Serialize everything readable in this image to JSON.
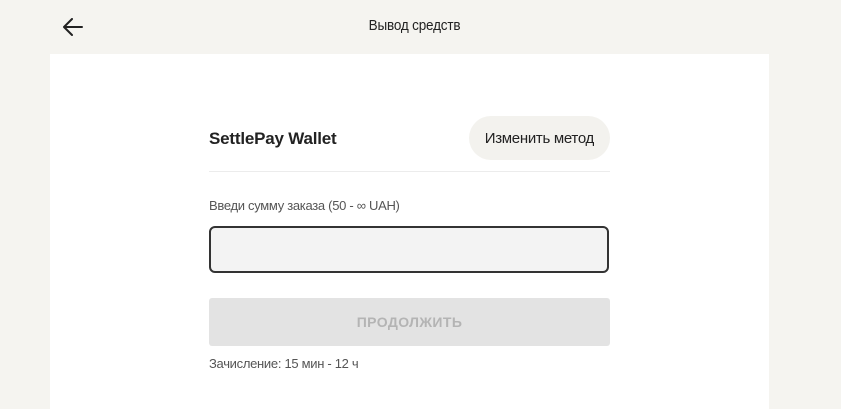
{
  "header": {
    "title": "Вывод средств",
    "back_icon": "arrow-left-icon"
  },
  "method": {
    "name": "SettlePay Wallet",
    "change_label": "Изменить метод"
  },
  "amount": {
    "label": "Введи сумму заказа (50 - ∞ UAH)",
    "value": "",
    "placeholder": ""
  },
  "continue": {
    "label": "ПРОДОЛЖИТЬ",
    "enabled": false
  },
  "note": {
    "credit_time": "Зачисление: 15 мин - 12 ч"
  },
  "colors": {
    "page_bg": "#f5f4f0",
    "card_bg": "#ffffff",
    "input_border": "#333333",
    "button_disabled_bg": "#e3e3e3",
    "button_disabled_text": "#b4b4b4"
  }
}
